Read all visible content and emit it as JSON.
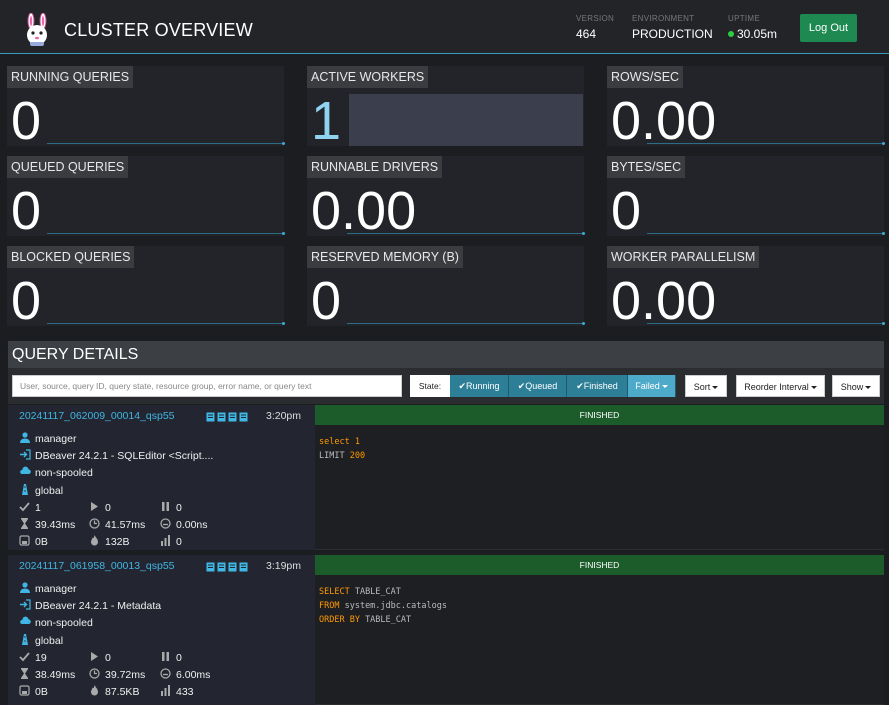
{
  "header": {
    "title": "CLUSTER OVERVIEW",
    "version_label": "VERSION",
    "version": "464",
    "environment_label": "ENVIRONMENT",
    "environment": "PRODUCTION",
    "uptime_label": "UPTIME",
    "uptime": "30.05m",
    "logout": "Log Out"
  },
  "metrics": [
    {
      "label": "RUNNING QUERIES",
      "value": "0"
    },
    {
      "label": "ACTIVE WORKERS",
      "value": "1"
    },
    {
      "label": "ROWS/SEC",
      "value": "0.00"
    },
    {
      "label": "QUEUED QUERIES",
      "value": "0"
    },
    {
      "label": "RUNNABLE DRIVERS",
      "value": "0.00"
    },
    {
      "label": "BYTES/SEC",
      "value": "0"
    },
    {
      "label": "BLOCKED QUERIES",
      "value": "0"
    },
    {
      "label": "RESERVED MEMORY (B)",
      "value": "0"
    },
    {
      "label": "WORKER PARALLELISM",
      "value": "0.00"
    }
  ],
  "query_details": {
    "title": "QUERY DETAILS",
    "search_placeholder": "User, source, query ID, query state, resource group, error name, or query text",
    "state_label": "State:",
    "states": [
      "Running",
      "Queued",
      "Finished",
      "Failed"
    ],
    "sort": "Sort",
    "reorder": "Reorder Interval",
    "show": "Show"
  },
  "queries": [
    {
      "id": "20241117_062009_00014_qsp55",
      "time": "3:20pm",
      "user": "manager",
      "source": "DBeaver 24.2.1 - SQLEditor <Script....",
      "spooling": "non-spooled",
      "resource_group": "global",
      "completed_splits": "1",
      "running_splits": "0",
      "queued_splits": "0",
      "wall_time": "39.43ms",
      "elapsed_time": "41.57ms",
      "cpu_time": "0.00ns",
      "memory": "0B",
      "peak_memory": "132B",
      "cumulative": "0",
      "status": "FINISHED",
      "sql_lines": [
        [
          {
            "t": "select ",
            "k": true
          },
          {
            "t": "1",
            "k": true
          }
        ],
        [
          {
            "t": "LIMIT ",
            "k": false
          },
          {
            "t": "200",
            "k": true
          }
        ]
      ]
    },
    {
      "id": "20241117_061958_00013_qsp55",
      "time": "3:19pm",
      "user": "manager",
      "source": "DBeaver 24.2.1 - Metadata",
      "spooling": "non-spooled",
      "resource_group": "global",
      "completed_splits": "19",
      "running_splits": "0",
      "queued_splits": "0",
      "wall_time": "38.49ms",
      "elapsed_time": "39.72ms",
      "cpu_time": "6.00ms",
      "memory": "0B",
      "peak_memory": "87.5KB",
      "cumulative": "433",
      "status": "FINISHED",
      "sql_lines": [
        [
          {
            "t": "SELECT ",
            "k": true
          },
          {
            "t": "TABLE_CAT",
            "k": false
          }
        ],
        [
          {
            "t": "FROM ",
            "k": true
          },
          {
            "t": "system.jdbc.catalogs",
            "k": false
          }
        ],
        [
          {
            "t": "ORDER BY ",
            "k": true
          },
          {
            "t": "TABLE_CAT",
            "k": false
          }
        ]
      ]
    }
  ],
  "colors": {
    "accent": "#3fb6e4",
    "finished": "#1c5b2a",
    "logout": "#1e8a52",
    "keyword": "#ff9900"
  },
  "icons": [
    "bunny-logo-icon",
    "user-icon",
    "source-icon",
    "cloud-icon",
    "resource-group-icon",
    "check-icon",
    "play-icon",
    "pause-icon",
    "hourglass-icon",
    "clock-icon",
    "cpu-icon",
    "memory-icon",
    "flame-icon",
    "bars-icon"
  ]
}
